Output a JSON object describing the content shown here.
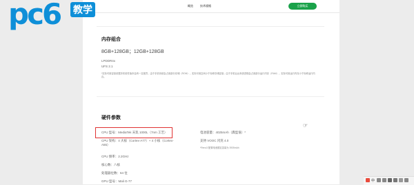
{
  "logo": {
    "main": "pc6",
    "sub": "教学"
  },
  "nav": {
    "items": [
      "概览",
      "技术规格"
    ],
    "button": "立即购买"
  },
  "memory": {
    "title": "内存组合",
    "options": "8GB+128GB；12GB+128GB",
    "ram": "LPDDR4x",
    "storage": "UFS 2.1",
    "note": "*实际可用容量依据手机软件版本会有一定差异，由于手机系统会占用部分存储（ROM），实际可用空间小于标称存储容量；由于手机后台系统进程会占用部分运行内存（RAM），实际可用运行内存小于标称运行内存。"
  },
  "hardware": {
    "title": "硬件参数",
    "left": [
      "CPU 型号：MediaTek 天玑 1000L（7nm 工艺）",
      "CPU 架构：4 大核（Cortex-A77）+ 4 小核（Cortex-A55）",
      "CPU 频率：2.2GHz",
      "核心数：八核",
      "处理器位数：64 位",
      "GPU 型号：Mali G-77"
    ],
    "right": [
      "电池容量：4025mAh（典型值）*",
      "支持 VOOC 闪充 4.0",
      "*Reno3 配置电池额定容量为 3935mAh"
    ]
  },
  "tray": {
    "label": "中"
  }
}
